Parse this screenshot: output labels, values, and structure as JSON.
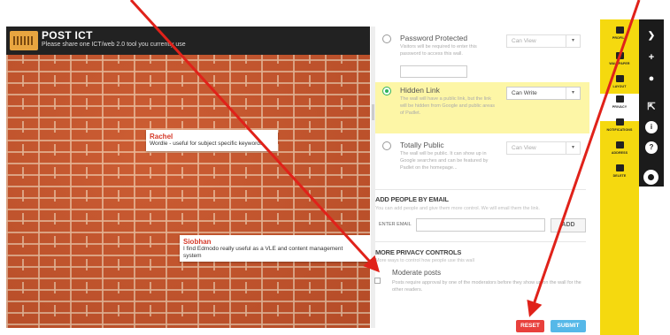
{
  "wall": {
    "title": "POST ICT",
    "subtitle": "Please share one ICT/web 2.0 tool you currently use",
    "posts": [
      {
        "author": "Rachel",
        "body": "Wordle - useful for subject specific keywords"
      },
      {
        "author": "Siobhan",
        "body": "I find Edmodo really useful as a VLE and content management\nsystem"
      }
    ]
  },
  "privacy": {
    "options": [
      {
        "title": "Password Protected",
        "description": "Visitors will be required to enter this password to access this wall.",
        "permission": "Can View",
        "selected": false
      },
      {
        "title": "Hidden Link",
        "description": "The wall will have a public link, but the link will be hidden from Google and public areas of Padlet.",
        "permission": "Can Write",
        "selected": true
      },
      {
        "title": "Totally Public",
        "description": "The wall will be public. It can show up in Google searches and can be featured by Padlet on the homepage...",
        "permission": "Can View",
        "selected": false
      }
    ],
    "add_people": {
      "title": "ADD PEOPLE BY EMAIL",
      "description": "You can add people and give them more control. We will email them the link.",
      "email_label": "ENTER EMAIL",
      "add_label": "ADD"
    },
    "more_controls": {
      "title": "MORE PRIVACY CONTROLS",
      "description": "More ways to control how people use this wall",
      "moderate_title": "Moderate posts",
      "moderate_desc": "Posts require approval by one of the moderators before they show up on the wall for the other readers."
    },
    "reset_label": "RESET",
    "submit_label": "SUBMIT"
  },
  "sidebar": {
    "items": [
      {
        "label": "PROFILE",
        "icon": "image-icon"
      },
      {
        "label": "WALLPAPER",
        "icon": "wallpaper-icon"
      },
      {
        "label": "LAYOUT",
        "icon": "layout-icon"
      },
      {
        "label": "PRIVACY",
        "icon": "lock-icon"
      },
      {
        "label": "NOTIFICATIONS",
        "icon": "notifications-icon"
      },
      {
        "label": "ADDRESS",
        "icon": "link-icon"
      },
      {
        "label": "DELETE",
        "icon": "trash-icon"
      }
    ],
    "active": "PRIVACY"
  },
  "rail": {
    "icons": [
      "chevron-icon",
      "plus-icon",
      "user-icon",
      "share-icon",
      "info-icon",
      "help-icon",
      "settings-icon"
    ]
  },
  "colors": {
    "brick": "#c2532b",
    "accent_yellow": "#f5d90f",
    "highlight": "#fdf6a6",
    "radio_on": "#2db35c",
    "reset": "#e8403c",
    "submit": "#56b8e8",
    "arrow": "#e0221a"
  }
}
